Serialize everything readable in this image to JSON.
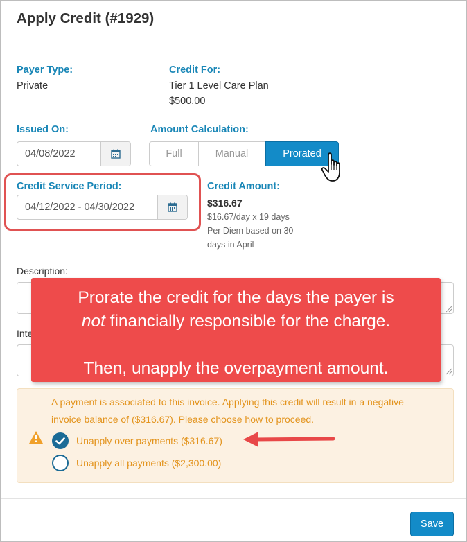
{
  "modal": {
    "title": "Apply Credit (#1929)"
  },
  "payer_type": {
    "label": "Payer Type:",
    "value": "Private"
  },
  "credit_for": {
    "label": "Credit For:",
    "plan": "Tier 1 Level Care Plan",
    "amount": "$500.00"
  },
  "issued_on": {
    "label": "Issued On:",
    "value": "04/08/2022"
  },
  "amount_calc": {
    "label": "Amount Calculation:",
    "options": [
      "Full",
      "Manual",
      "Prorated"
    ],
    "selected": "Prorated"
  },
  "service_period": {
    "label": "Credit Service Period:",
    "value": "04/12/2022 - 04/30/2022"
  },
  "credit_amount": {
    "label": "Credit Amount:",
    "value": "$316.67",
    "detail1": "$16.67/day x 19 days",
    "detail2": "Per Diem based on 30",
    "detail3": "days in April"
  },
  "description": {
    "label": "Description:"
  },
  "internal": {
    "label_partial": "Inte"
  },
  "callout": {
    "line1": "Prorate the credit for the days the payer is",
    "line2_em": "not",
    "line2_rest": " financially responsible for the charge.",
    "line3": "Then, unapply the overpayment amount."
  },
  "warning": {
    "line1": "A payment is associated to this invoice. Applying this credit will result in a negative",
    "line2": "invoice balance of ($316.67). Please choose how to proceed.",
    "option1": "Unapply over payments ($316.67)",
    "option2": "Unapply all payments ($2,300.00)",
    "selected": "option1"
  },
  "footer": {
    "save_label": "Save"
  },
  "colors": {
    "accent": "#1a87b7",
    "primary": "#138bc8",
    "callout": "#ee4b4b",
    "warning_text": "#e3941e",
    "warning_bg": "#fcf1e2"
  }
}
